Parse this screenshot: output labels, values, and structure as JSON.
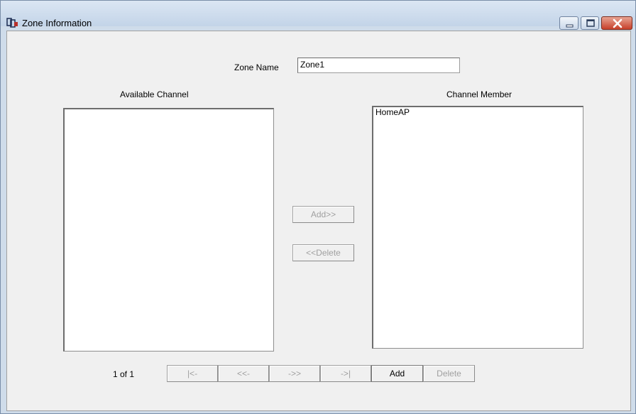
{
  "window": {
    "title": "Zone Information",
    "icon": "zone-app-icon",
    "controls": [
      "minimize-icon",
      "maximize-icon",
      "close-icon"
    ]
  },
  "zone": {
    "name_label": "Zone Name",
    "name_value": "Zone1"
  },
  "available": {
    "label": "Available Channel",
    "items": []
  },
  "members": {
    "label": "Channel Member",
    "items": [
      "HomeAP"
    ]
  },
  "buttons": {
    "add": "Add>>",
    "delete": "<<Delete"
  },
  "pager": {
    "status": "1 of 1",
    "first": "|<-",
    "prev": "<<-",
    "next": "->>",
    "last": "->|",
    "add": "Add",
    "delete": "Delete"
  },
  "colors": {
    "disabled_text": "#a0a0a0",
    "close_button": "#c7402a"
  }
}
